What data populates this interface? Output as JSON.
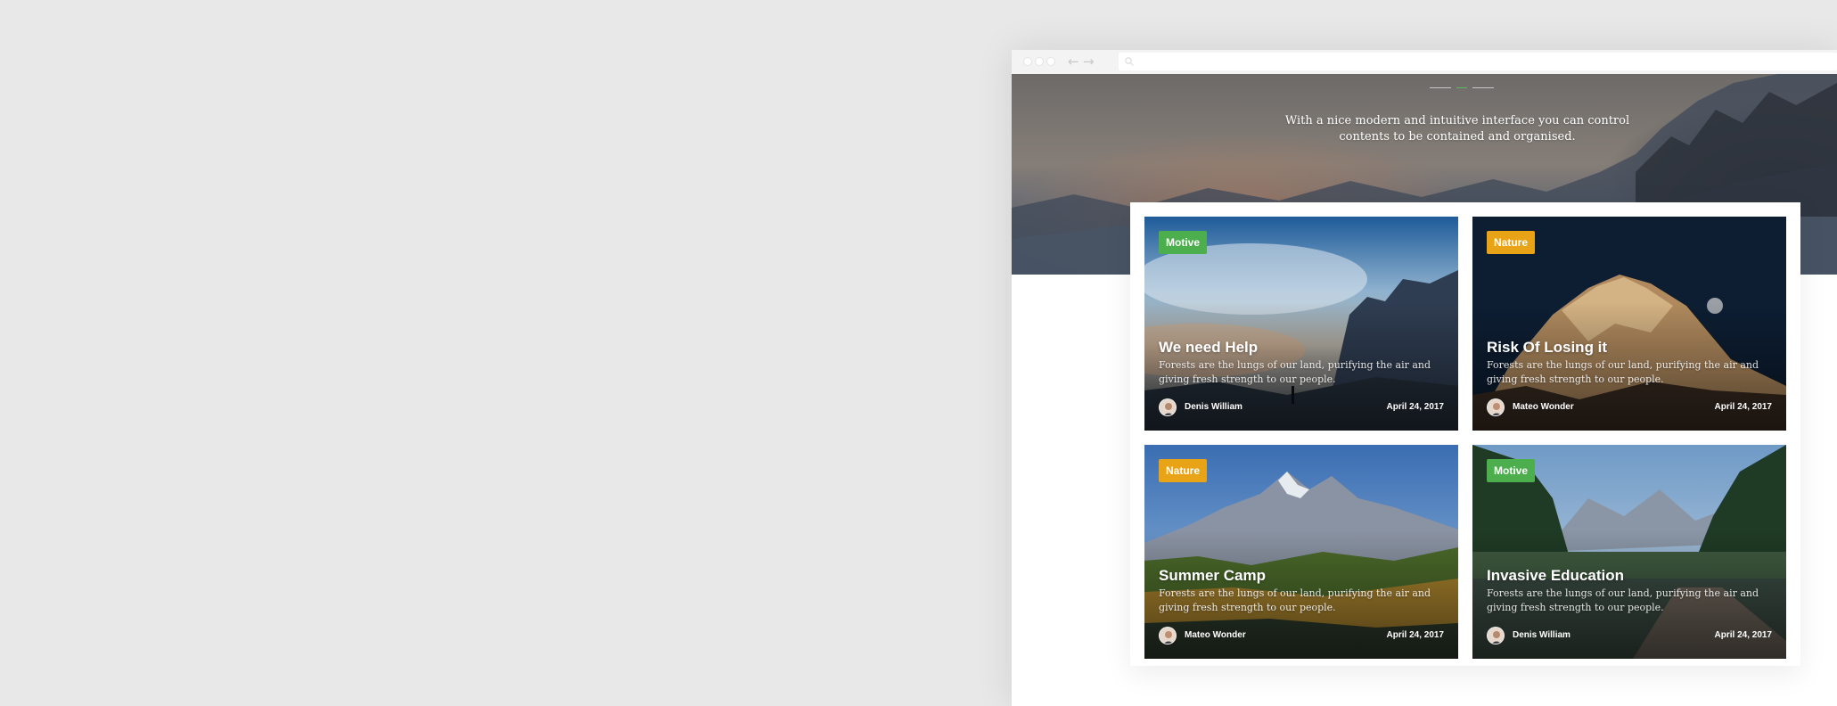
{
  "browser": {
    "back_arrow": "←",
    "forward_arrow": "→",
    "url": ""
  },
  "hero": {
    "subtitle": "With a nice modern and intuitive interface you can control contents to be contained and organised.",
    "accent_color": "#5cb85c"
  },
  "cards": [
    {
      "category": "Motive",
      "category_color": "#4cae4c",
      "title": "We need Help",
      "description": "Forests are the lungs of our land, purifying the air and giving fresh strength to our people.",
      "author": "Denis William",
      "date": "April 24, 2017"
    },
    {
      "category": "Nature",
      "category_color": "#e8a317",
      "title": "Risk Of Losing it",
      "description": "Forests are the lungs of our land, purifying the air and giving fresh strength to our people.",
      "author": "Mateo Wonder",
      "date": "April 24, 2017"
    },
    {
      "category": "Nature",
      "category_color": "#e8a317",
      "title": "Summer Camp",
      "description": "Forests are the lungs of our land, purifying the air and giving fresh strength to our people.",
      "author": "Mateo Wonder",
      "date": "April 24, 2017"
    },
    {
      "category": "Motive",
      "category_color": "#4cae4c",
      "title": "Invasive Education",
      "description": "Forests are the lungs of our land, purifying the air and giving fresh strength to our people.",
      "author": "Denis William",
      "date": "April 24, 2017"
    }
  ]
}
